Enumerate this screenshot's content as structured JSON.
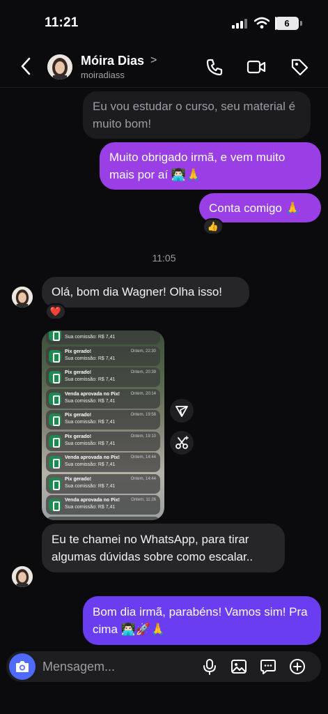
{
  "status": {
    "time": "11:21",
    "battery": "6",
    "battery_pct": 6
  },
  "header": {
    "name": "Móira Dias",
    "chevron": ">",
    "handle": "moiradiass",
    "icons": [
      "back-icon",
      "phone-icon",
      "video-icon",
      "tag-icon"
    ]
  },
  "messages": [
    {
      "dir": "in",
      "text": "Eu vou estudar o curso, seu material é muito bom!"
    },
    {
      "dir": "out",
      "text": "Muito obrigado irmã, e vem muito mais por aí 👨🏻‍💻🙏"
    },
    {
      "dir": "out",
      "text": "Conta comigo 🙏",
      "reaction": "👍"
    },
    {
      "dir": "in",
      "text": "Olá, bom dia Wagner! Olha isso!",
      "reaction": "❤️"
    },
    {
      "dir": "in",
      "text": "Eu te chamei no WhatsApp, para tirar algumas dúvidas sobre como escalar.."
    },
    {
      "dir": "out",
      "text": "Bom dia irmã, parabéns! Vamos sim! Pra cima 👨🏻‍💻🚀🙏"
    }
  ],
  "timestamp": "11:05",
  "shared_image": {
    "notifications": [
      {
        "title": "",
        "body": "Sua comissão: R$ 7,41",
        "time": ""
      },
      {
        "title": "Pix gerado!",
        "body": "Sua comissão: R$ 7,41",
        "time": "Ontem, 22:30"
      },
      {
        "title": "Pix gerado!",
        "body": "Sua comissão: R$ 7,41",
        "time": "Ontem, 20:39"
      },
      {
        "title": "Venda aprovada no Pix!",
        "body": "Sua comissão: R$ 7,41",
        "time": "Ontem, 20:14"
      },
      {
        "title": "Pix gerado!",
        "body": "Sua comissão: R$ 7,41",
        "time": "Ontem, 19:58"
      },
      {
        "title": "Pix gerado!",
        "body": "Sua comissão: R$ 7,41",
        "time": "Ontem, 19:10"
      },
      {
        "title": "Venda aprovada no Pix!",
        "body": "Sua comissão: R$ 7,41",
        "time": "Ontem, 14:44"
      },
      {
        "title": "Pix gerado!",
        "body": "Sua comissão: R$ 7,41",
        "time": "Ontem, 14:44"
      },
      {
        "title": "Venda aprovada no Pix!",
        "body": "Sua comissão: R$ 7,41",
        "time": "Ontem, 11:26"
      },
      {
        "title": "",
        "body": "Sua comissão: R$ 7,41",
        "time": ""
      }
    ]
  },
  "composer": {
    "placeholder": "Mensagem..."
  },
  "colors": {
    "bg": "#0b0b0d",
    "incoming": "#262629",
    "outgoing_purple": "#9a3ee6",
    "outgoing_blue": "#6b3df0",
    "camera": "#4f6bff"
  }
}
